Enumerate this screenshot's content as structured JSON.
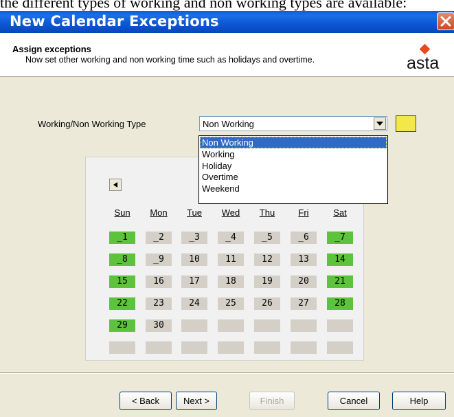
{
  "doc_fragment": "the different types of working and non working types are available:",
  "window": {
    "title": "New Calendar Exceptions"
  },
  "header": {
    "title": "Assign exceptions",
    "subtitle": "Now set other working and non working time such as holidays and overtime.",
    "logo_text": "asta"
  },
  "type_field": {
    "label": "Working/Non Working Type",
    "value": "Non Working",
    "swatch_color": "#f2e84a",
    "options": [
      "Non Working",
      "Working",
      "Holiday",
      "Overtime",
      "Weekend"
    ],
    "selected_index": 0
  },
  "calendar": {
    "days_of_week": [
      "Sun",
      "Mon",
      "Tue",
      "Wed",
      "Thu",
      "Fri",
      "Sat"
    ],
    "weeks": [
      [
        "_1",
        "_2",
        "_3",
        "_4",
        "_5",
        "_6",
        "_7"
      ],
      [
        "_8",
        "_9",
        "10",
        "11",
        "12",
        "13",
        "14"
      ],
      [
        "15",
        "16",
        "17",
        "18",
        "19",
        "20",
        "21"
      ],
      [
        "22",
        "23",
        "24",
        "25",
        "26",
        "27",
        "28"
      ],
      [
        "29",
        "30",
        "",
        "",
        "",
        "",
        ""
      ],
      [
        "",
        "",
        "",
        "",
        "",
        "",
        ""
      ]
    ],
    "working_color": "#5dc23c",
    "normal_color": "#d4d0c8"
  },
  "buttons": {
    "back": "< Back",
    "next": "Next >",
    "finish": "Finish",
    "cancel": "Cancel",
    "help": "Help"
  }
}
